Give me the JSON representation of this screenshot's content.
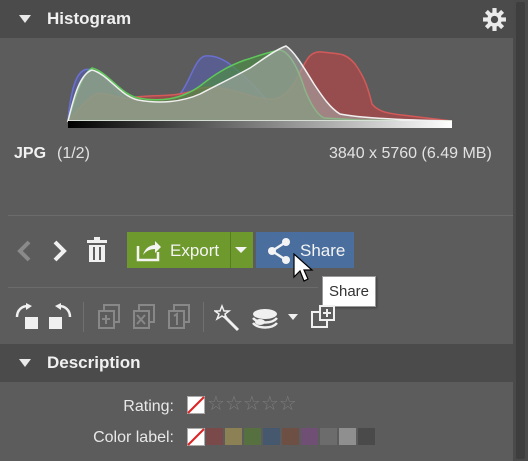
{
  "histogram": {
    "title": "Histogram",
    "settings_icon": "gear-icon"
  },
  "file_info": {
    "type": "JPG",
    "count": "(1/2)",
    "dimensions": "3840 x 5760 (6.49 MB)"
  },
  "toolbar": {
    "export_label": "Export",
    "share_label": "Share",
    "tooltip": "Share",
    "icons": [
      "chevron-left-icon",
      "chevron-right-icon",
      "trash-icon",
      "export-icon",
      "dropdown-arrow-icon",
      "share-icon"
    ]
  },
  "tools": {
    "icons": [
      "rotate-left-icon",
      "rotate-right-icon",
      "copy-icon",
      "remove-copy-icon",
      "duplicate-icon",
      "magic-wand-icon",
      "layers-icon",
      "add-to-album-icon"
    ]
  },
  "description": {
    "title": "Description",
    "rating_label": "Rating:",
    "rating_value": 0,
    "rating_max": 5,
    "color_label": "Color label:",
    "colors": [
      "#7a4a4a",
      "#8b8155",
      "#56703f",
      "#46586e",
      "#6d4f43",
      "#704f75",
      "#6c6c6c",
      "#8f8f8f",
      "#4a4a4a"
    ]
  }
}
